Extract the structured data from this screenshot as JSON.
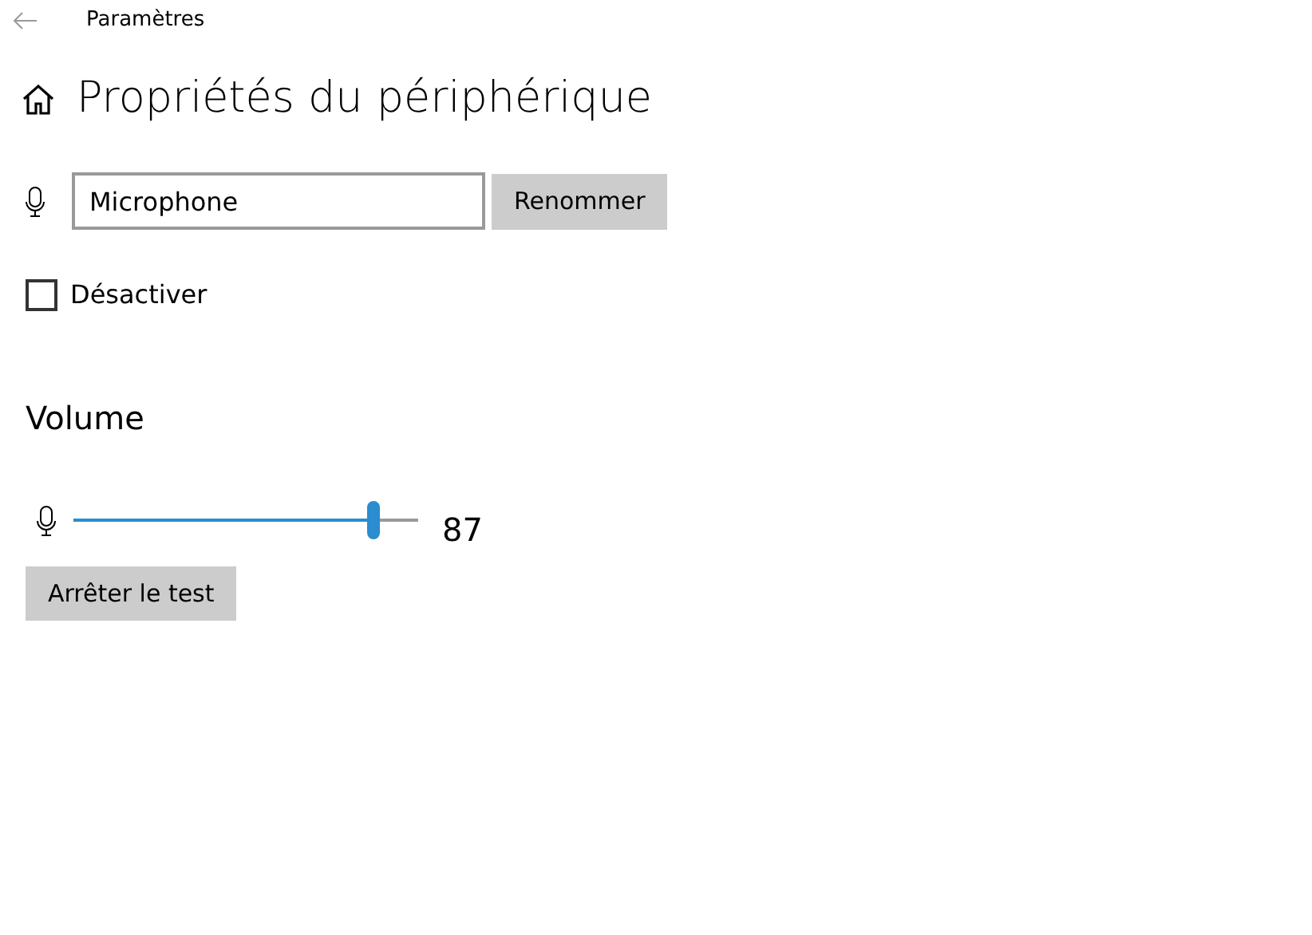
{
  "window": {
    "title": "Paramètres"
  },
  "page": {
    "title": "Propriétés du périphérique"
  },
  "name_field": {
    "value": "Microphone"
  },
  "rename_button": {
    "label": "Renommer"
  },
  "disable_checkbox": {
    "label": "Désactiver",
    "checked": false
  },
  "volume": {
    "heading": "Volume",
    "level": 0.87,
    "reading": "87"
  },
  "test_button": {
    "label": "Arrêter le test"
  }
}
